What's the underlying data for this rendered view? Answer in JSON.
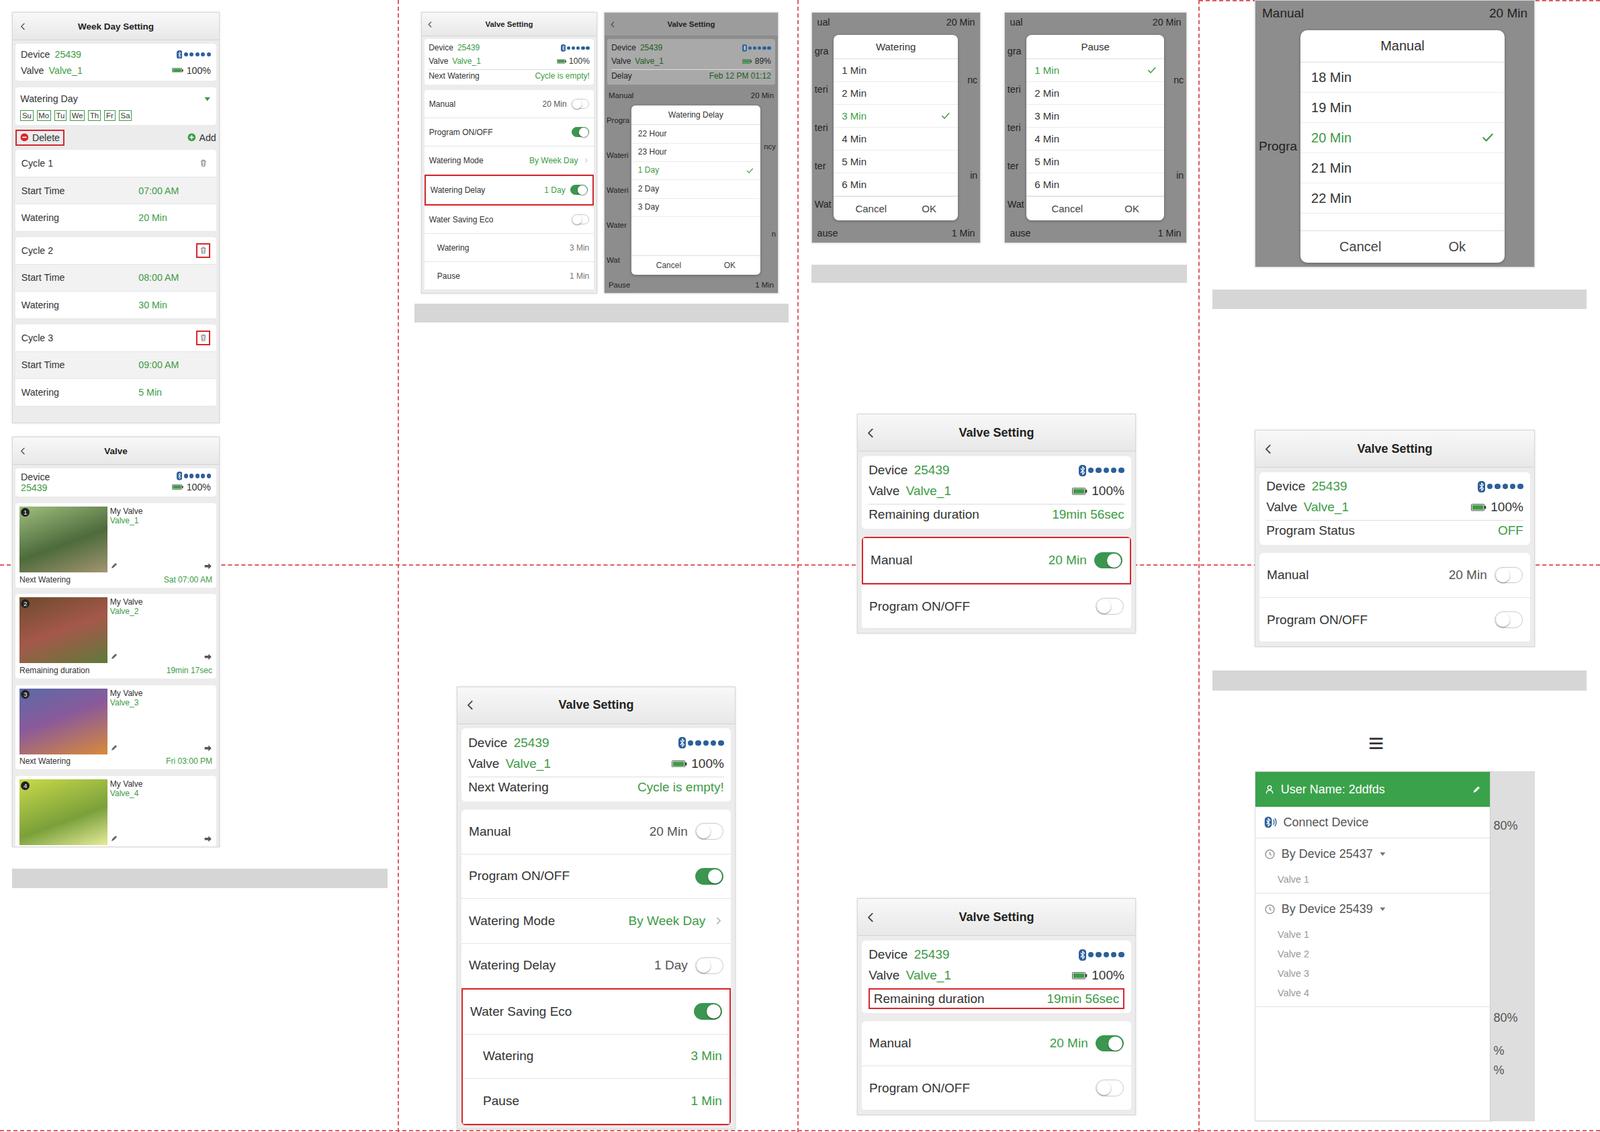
{
  "week_day_setting": {
    "title": "Week Day Setting",
    "header": {
      "device_label": "Device",
      "device_value": "25439",
      "valve_label": "Valve",
      "valve_value": "Valve_1",
      "battery": "100%",
      "signal": 1
    },
    "watering_day": {
      "label": "Watering Day",
      "expanded": true,
      "days": [
        {
          "label": "Su",
          "selected": false
        },
        {
          "label": "Mo",
          "selected": false
        },
        {
          "label": "Tu",
          "selected": false
        },
        {
          "label": "We",
          "selected": false
        },
        {
          "label": "Th",
          "selected": false
        },
        {
          "label": "Fr",
          "selected": false
        },
        {
          "label": "Sa",
          "selected": false
        }
      ]
    },
    "delete": {
      "label": "Delete",
      "highlighted": true
    },
    "add": {
      "label": "Add"
    },
    "cycles": [
      {
        "title": "Cycle 1",
        "trash_highlighted": false,
        "rows": [
          {
            "label": "Start Time",
            "value": "07:00 AM"
          },
          {
            "label": "Watering",
            "value": "20 Min"
          }
        ]
      },
      {
        "title": "Cycle 2",
        "trash_highlighted": true,
        "rows": [
          {
            "label": "Start Time",
            "value": "08:00 AM"
          },
          {
            "label": "Watering",
            "value": "30 Min"
          }
        ]
      },
      {
        "title": "Cycle 3",
        "trash_highlighted": true,
        "rows": [
          {
            "label": "Start Time",
            "value": "09:00 AM"
          },
          {
            "label": "Watering",
            "value": "5 Min"
          }
        ]
      }
    ]
  },
  "valve_list": {
    "title": "Valve",
    "device_label": "Device",
    "device_value": "25439",
    "battery": "100%",
    "signal": 1,
    "valves": [
      {
        "badge": "1",
        "name": "My Valve",
        "valve": "Valve_1",
        "status_label": "Next Watering",
        "status_value": "Sat 07:00 AM"
      },
      {
        "badge": "2",
        "name": "My Valve",
        "valve": "Valve_2",
        "status_label": "Remaining duration",
        "status_value": "19min 17sec"
      },
      {
        "badge": "3",
        "name": "My Valve",
        "valve": "Valve_3",
        "status_label": "Next Watering",
        "status_value": "Fri 03:00 PM"
      },
      {
        "badge": "4",
        "name": "My Valve",
        "valve": "Valve_4"
      }
    ]
  },
  "valve_settings": [
    {
      "title": "Valve Setting",
      "header": {
        "device_label": "Device",
        "device_value": "25439",
        "valve_label": "Valve",
        "valve_value": "Valve_1",
        "battery": "100%",
        "signal": 1,
        "extra": [
          {
            "label": "Next Watering",
            "value": "Cycle is empty!",
            "highlighted": false
          }
        ]
      },
      "rows": [
        {
          "label": "Manual",
          "value": "20 Min",
          "kind": "toggle",
          "on": false,
          "indent": false,
          "highlighted": false
        },
        {
          "label": "Program ON/OFF",
          "kind": "toggle",
          "on": true,
          "indent": false,
          "highlighted": false
        },
        {
          "label": "Watering Mode",
          "value": "By Week Day",
          "kind": "link",
          "on": true,
          "indent": false,
          "highlighted": false
        },
        {
          "label": "Watering Delay",
          "value": "1 Day",
          "kind": "toggle",
          "on": true,
          "indent": false,
          "highlighted": true
        },
        {
          "label": "Water Saving Eco",
          "kind": "toggle",
          "on": false,
          "indent": false,
          "highlighted": false
        },
        {
          "label": "Watering",
          "value": "3 Min",
          "kind": "value",
          "on": false,
          "indent": true,
          "highlighted": false
        },
        {
          "label": "Pause",
          "value": "1 Min",
          "kind": "value",
          "on": false,
          "indent": true,
          "highlighted": false
        }
      ]
    },
    {
      "title": "Valve Setting",
      "header": {
        "device_label": "Device",
        "device_value": "25439",
        "valve_label": "Valve",
        "valve_value": "Valve_1",
        "battery": "100%",
        "signal": 1,
        "extra": [
          {
            "label": "Next Watering",
            "value": "Cycle is empty!",
            "highlighted": false
          }
        ]
      },
      "rows": [
        {
          "label": "Manual",
          "value": "20 Min",
          "kind": "toggle",
          "on": false,
          "indent": false,
          "highlighted": false
        },
        {
          "label": "Program ON/OFF",
          "kind": "toggle",
          "on": true,
          "indent": false,
          "highlighted": false
        },
        {
          "label": "Watering Mode",
          "value": "By Week Day",
          "kind": "link",
          "on": true,
          "indent": false,
          "highlighted": false
        },
        {
          "label": "Watering Delay",
          "value": "1 Day",
          "kind": "toggle",
          "on": false,
          "indent": false,
          "highlighted": false
        },
        {
          "label": "Water Saving Eco",
          "kind": "toggle",
          "on": true,
          "indent": false,
          "highlighted": true
        },
        {
          "label": "Watering",
          "value": "3 Min",
          "kind": "value",
          "on": true,
          "indent": true,
          "highlighted": true
        },
        {
          "label": "Pause",
          "value": "1 Min",
          "kind": "value",
          "on": true,
          "indent": true,
          "highlighted": true
        }
      ]
    },
    {
      "title": "Valve Setting",
      "header": {
        "device_label": "Device",
        "device_value": "25439",
        "valve_label": "Valve",
        "valve_value": "Valve_1",
        "battery": "100%",
        "signal": 1,
        "extra": [
          {
            "label": "Remaining duration",
            "value": "19min 56sec",
            "highlighted": false
          }
        ]
      },
      "rows": [
        {
          "label": "Manual",
          "value": "20 Min",
          "kind": "toggle",
          "on": true,
          "indent": false,
          "highlighted": true
        },
        {
          "label": "Program ON/OFF",
          "kind": "toggle",
          "on": false,
          "indent": false,
          "highlighted": false
        }
      ]
    },
    {
      "title": "Valve Setting",
      "header": {
        "device_label": "Device",
        "device_value": "25439",
        "valve_label": "Valve",
        "valve_value": "Valve_1",
        "battery": "100%",
        "signal": 1,
        "extra": [
          {
            "label": "Remaining duration",
            "value": "19min 56sec",
            "highlighted": true
          }
        ]
      },
      "rows": [
        {
          "label": "Manual",
          "value": "20 Min",
          "kind": "toggle",
          "on": true,
          "indent": false,
          "highlighted": false
        },
        {
          "label": "Program ON/OFF",
          "kind": "toggle",
          "on": false,
          "indent": false,
          "highlighted": false
        }
      ]
    },
    {
      "title": "Valve Setting",
      "header": {
        "device_label": "Device",
        "device_value": "25439",
        "valve_label": "Valve",
        "valve_value": "Valve_1",
        "battery": "100%",
        "signal": 1,
        "extra": [
          {
            "label": "Program Status",
            "value": "OFF",
            "highlighted": false
          }
        ]
      },
      "rows": [
        {
          "label": "Manual",
          "value": "20 Min",
          "kind": "toggle",
          "on": false,
          "indent": false,
          "highlighted": false
        },
        {
          "label": "Program ON/OFF",
          "kind": "toggle",
          "on": false,
          "indent": false,
          "highlighted": false
        }
      ]
    }
  ],
  "delay_picker": {
    "title": "Valve Setting",
    "header": {
      "device_label": "Device",
      "device_value": "25439",
      "valve_label": "Valve",
      "valve_value": "Valve_1",
      "battery": "89%",
      "signal": 1,
      "extra": [
        {
          "label": "Delay",
          "value": "Feb 12 PM 01:12",
          "highlighted": false
        }
      ]
    },
    "top_rows": [
      {
        "left": "Manual",
        "right": "20 Min"
      }
    ],
    "left": [
      "Progra",
      "Wateri",
      "Wateri",
      "Water",
      "Wat"
    ],
    "right": [
      "ncy",
      "n"
    ],
    "bottom_rows": [
      {
        "left": "Pause",
        "right": "1 Min"
      }
    ],
    "popup": {
      "title": "Watering Delay",
      "options": [
        {
          "label": "22 Hour",
          "selected": false
        },
        {
          "label": "23 Hour",
          "selected": false
        },
        {
          "label": "1 Day",
          "selected": true
        },
        {
          "label": "2 Day",
          "selected": false
        },
        {
          "label": "3 Day",
          "selected": false
        }
      ],
      "buttons": [
        "Cancel",
        "OK"
      ]
    }
  },
  "pickers": [
    {
      "top_rows": [
        {
          "left": "ual",
          "right": "20 Min"
        }
      ],
      "left": [
        "gra",
        "teri",
        "teri",
        "ter",
        "Wat"
      ],
      "right": [
        "nc",
        "in"
      ],
      "bottom_rows": [
        {
          "left": "ause",
          "right": "1 Min"
        }
      ],
      "popup": {
        "title": "Watering",
        "options": [
          {
            "label": "1 Min",
            "selected": false
          },
          {
            "label": "2 Min",
            "selected": false
          },
          {
            "label": "3 Min",
            "selected": true
          },
          {
            "label": "4 Min",
            "selected": false
          },
          {
            "label": "5 Min",
            "selected": false
          },
          {
            "label": "6 Min",
            "selected": false
          }
        ],
        "buttons": [
          "Cancel",
          "OK"
        ]
      }
    },
    {
      "top_rows": [
        {
          "left": "ual",
          "right": "20 Min"
        }
      ],
      "left": [
        "gra",
        "teri",
        "teri",
        "ter",
        "Wat"
      ],
      "right": [
        "nc",
        "in"
      ],
      "bottom_rows": [
        {
          "left": "ause",
          "right": "1 Min"
        }
      ],
      "popup": {
        "title": "Pause",
        "options": [
          {
            "label": "1 Min",
            "selected": true
          },
          {
            "label": "2 Min",
            "selected": false
          },
          {
            "label": "3 Min",
            "selected": false
          },
          {
            "label": "4 Min",
            "selected": false
          },
          {
            "label": "5 Min",
            "selected": false
          },
          {
            "label": "6 Min",
            "selected": false
          }
        ],
        "buttons": [
          "Cancel",
          "OK"
        ]
      }
    }
  ],
  "manual_picker": {
    "top_rows": [
      {
        "left": "Manual",
        "right": "20 Min"
      }
    ],
    "left": [
      "Progra"
    ],
    "right": [],
    "bottom_rows": [],
    "popup": {
      "title": "Manual",
      "options": [
        {
          "label": "18 Min",
          "selected": false
        },
        {
          "label": "19 Min",
          "selected": false
        },
        {
          "label": "20 Min",
          "selected": true
        },
        {
          "label": "21 Min",
          "selected": false
        },
        {
          "label": "22 Min",
          "selected": false
        }
      ],
      "buttons": [
        "Cancel",
        "Ok"
      ]
    }
  },
  "menu_symbol": "≡",
  "side_menu": {
    "user_name": "User Name: 2ddfds",
    "connect": "Connect Device",
    "groups": [
      {
        "label": "By Device 25437",
        "expanded": true,
        "valves": [
          "Valve 1"
        ]
      },
      {
        "label": "By Device 25439",
        "expanded": true,
        "valves": [
          "Valve 1",
          "Valve 2",
          "Valve 3",
          "Valve 4"
        ]
      }
    ],
    "background_right": [
      "80%",
      "80%",
      "%",
      "%"
    ]
  }
}
